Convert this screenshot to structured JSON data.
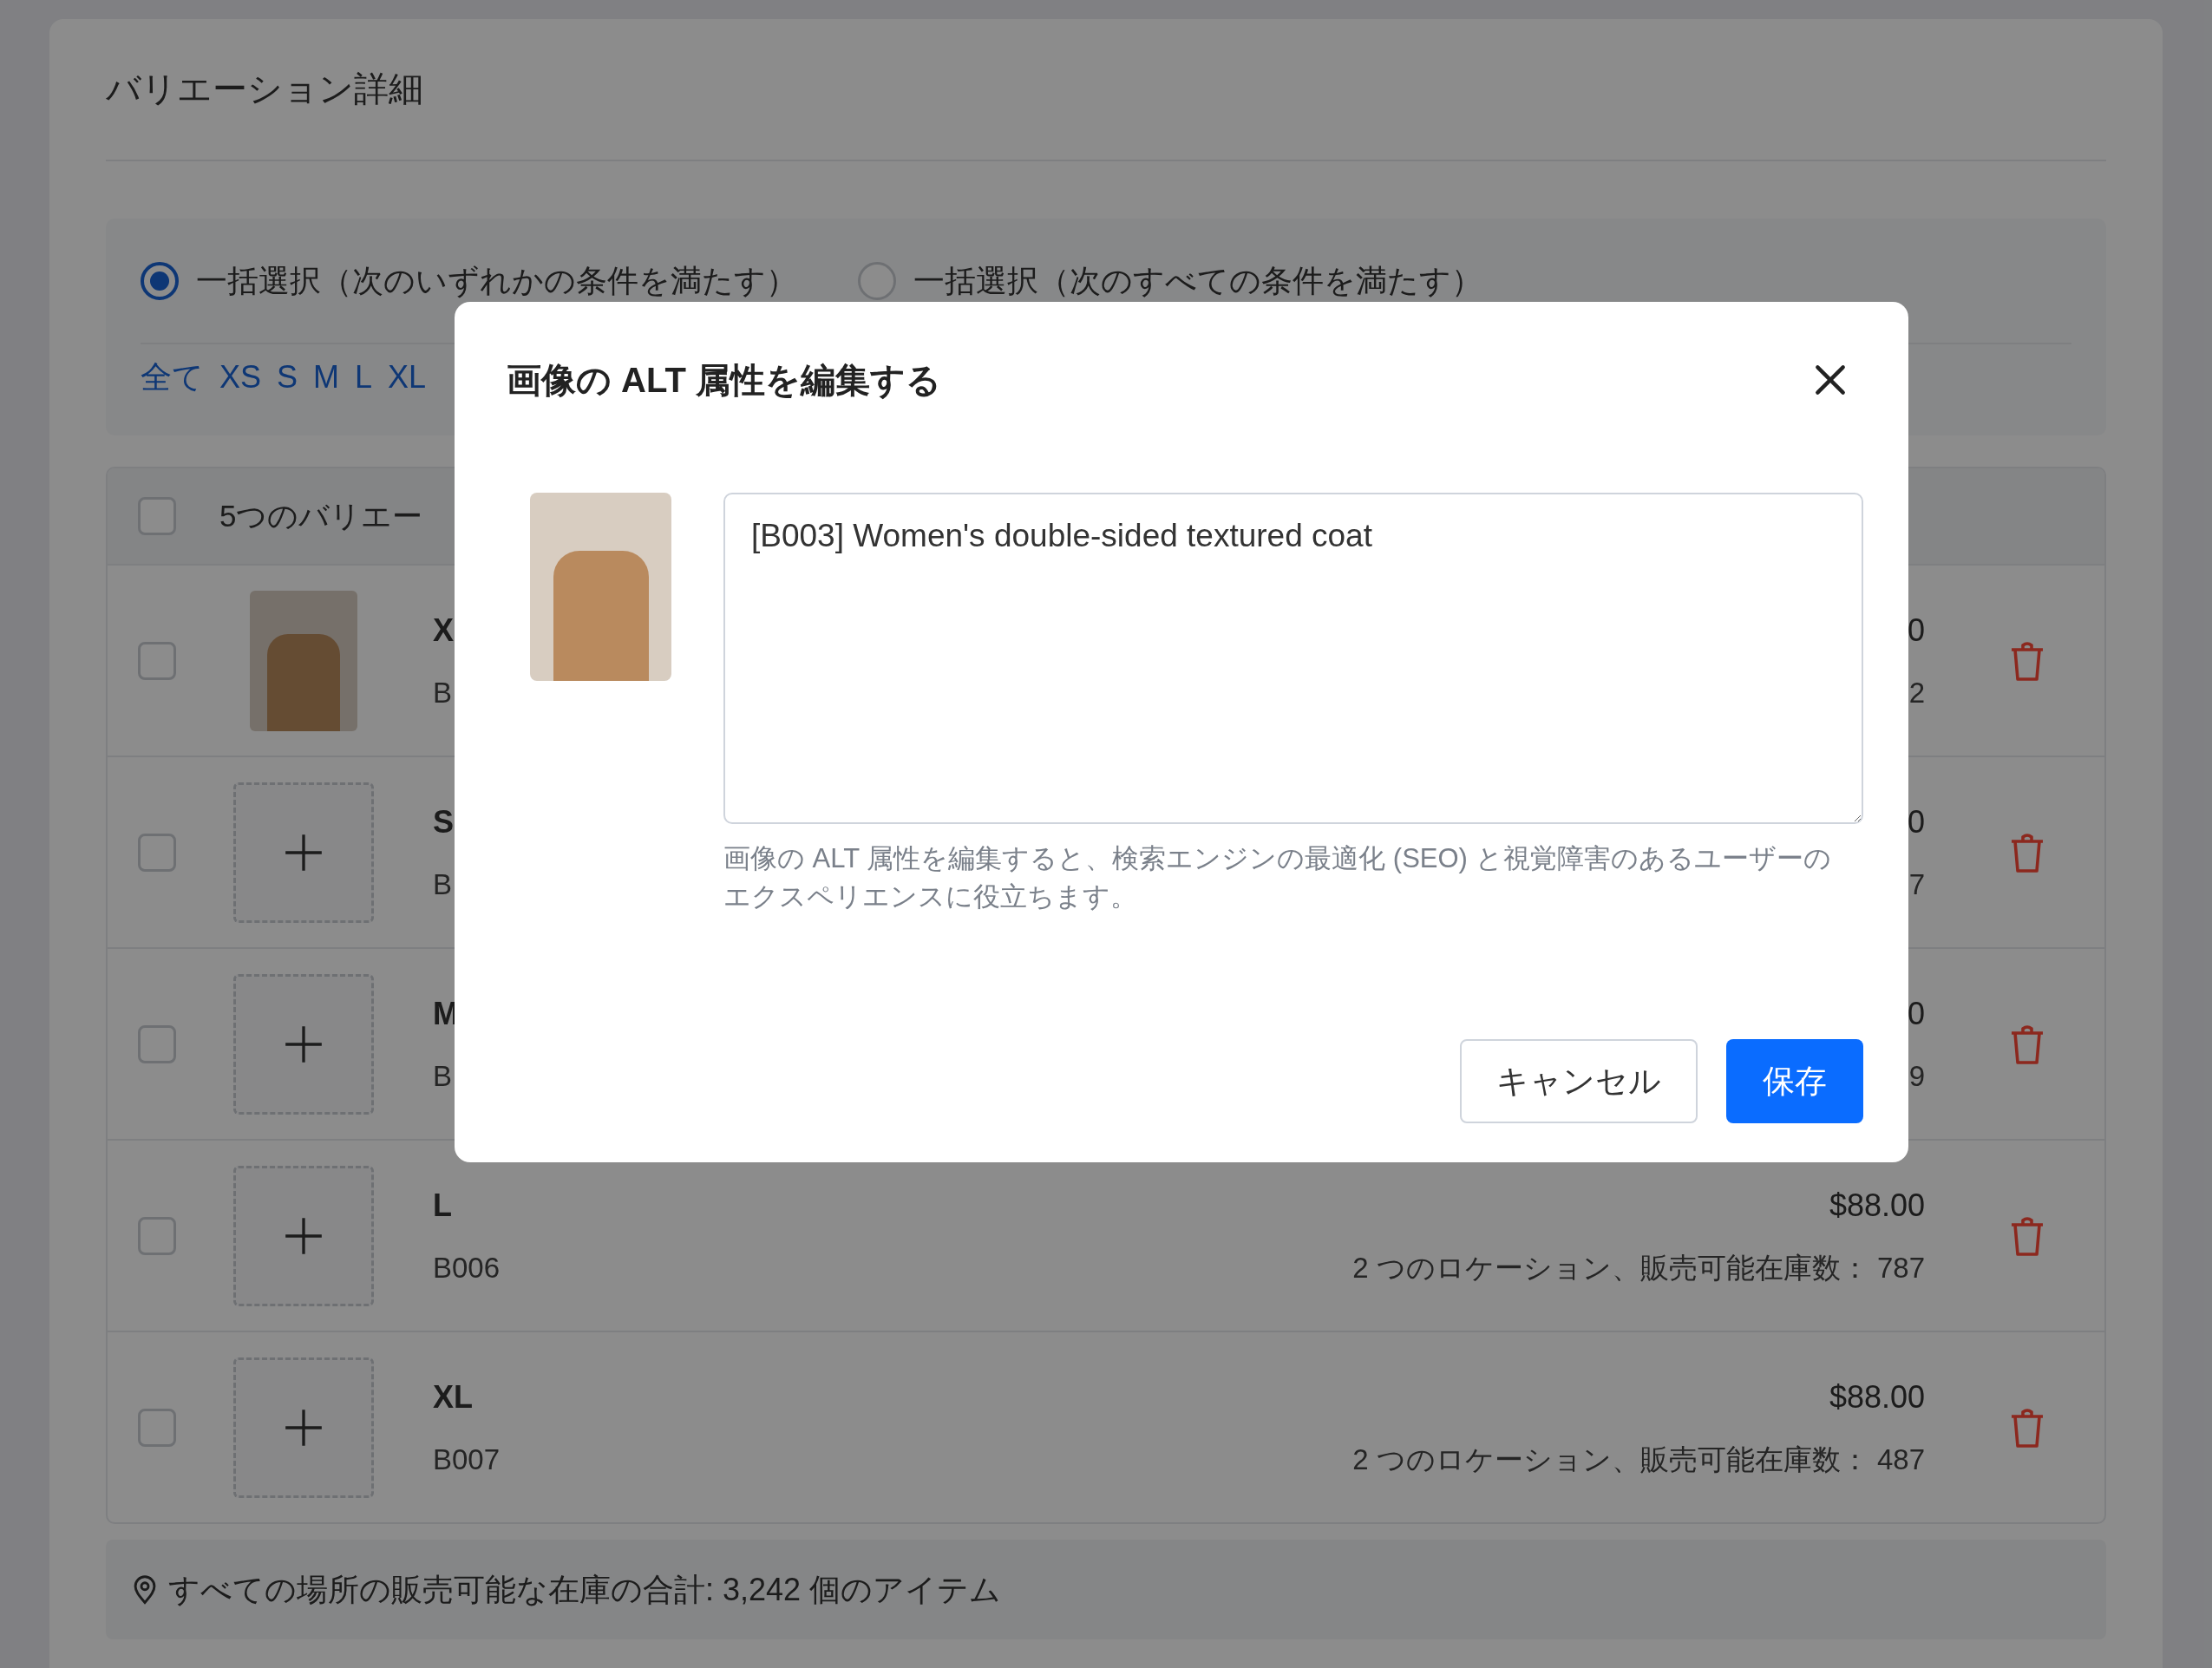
{
  "page": {
    "title": "バリエーション詳細"
  },
  "filter": {
    "modes": [
      {
        "label": "一括選択（次のいずれかの条件を満たす）",
        "selected": true
      },
      {
        "label": "一括選択（次のすべての条件を満たす）",
        "selected": false
      }
    ],
    "sizes": [
      "全て",
      "XS",
      "S",
      "M",
      "L",
      "XL"
    ]
  },
  "table": {
    "header": {
      "checked": false,
      "label": "5つのバリエー"
    },
    "rows": [
      {
        "kind": "photo",
        "checked": false,
        "title": "X",
        "sku": "B",
        "price": "0",
        "stock": "2"
      },
      {
        "kind": "empty",
        "checked": false,
        "title": "S",
        "sku": "B",
        "price": "0",
        "stock": "7"
      },
      {
        "kind": "empty",
        "checked": false,
        "title": "M",
        "sku": "B",
        "price": "0",
        "stock": "9"
      },
      {
        "kind": "empty",
        "checked": false,
        "title": "L",
        "sku": "B006",
        "price": "$88.00",
        "stock": "2 つのロケーション、販売可能在庫数： 787"
      },
      {
        "kind": "empty",
        "checked": false,
        "title": "XL",
        "sku": "B007",
        "price": "$88.00",
        "stock": "2 つのロケーション、販売可能在庫数： 487"
      }
    ]
  },
  "footer": {
    "text": "すべての場所の販売可能な在庫の合計: 3,242 個のアイテム"
  },
  "modal": {
    "title": "画像の ALT 属性を編集する",
    "value": "[B003] Women's double-sided textured coat",
    "hint": "画像の ALT 属性を編集すると、検索エンジンの最適化 (SEO) と視覚障害のあるユーザーのエクスペリエンスに役立ちます。",
    "buttons": [
      {
        "label": "キャンセル",
        "kind": "secondary"
      },
      {
        "label": "保存",
        "kind": "primary"
      }
    ]
  }
}
